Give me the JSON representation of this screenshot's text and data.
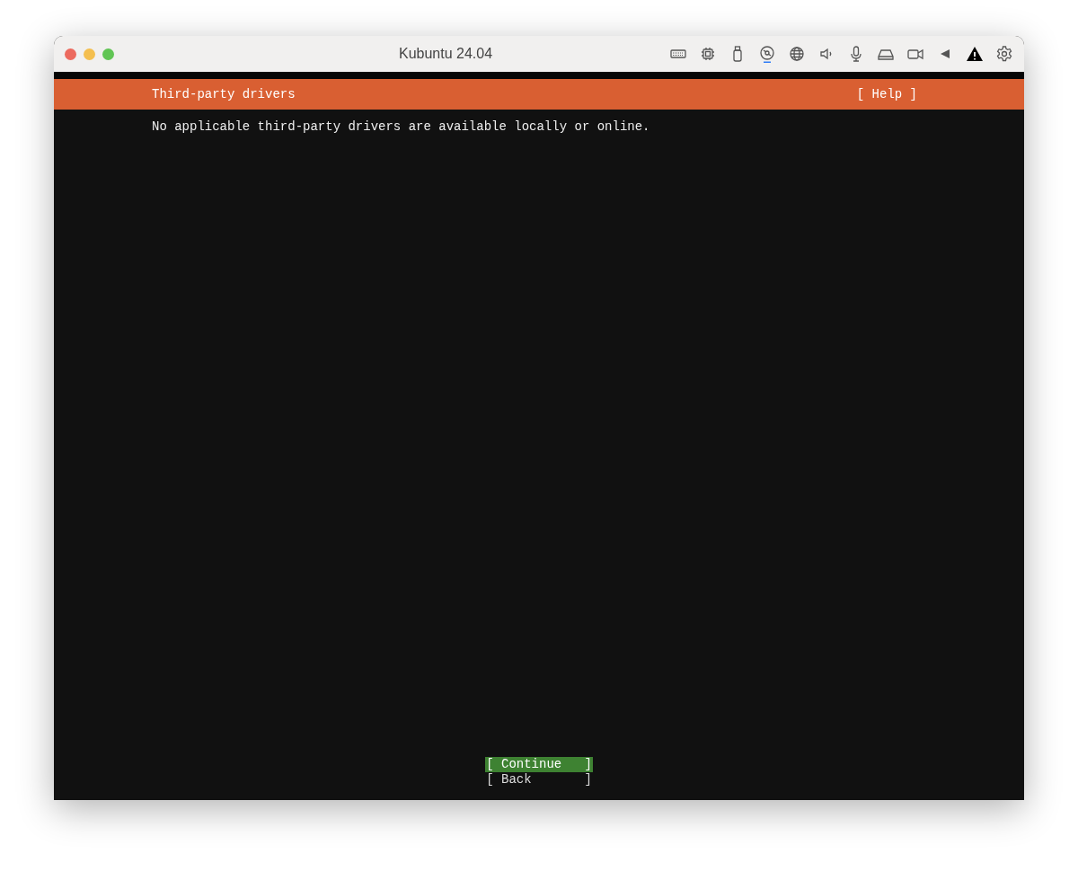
{
  "window": {
    "title": "Kubuntu 24.04"
  },
  "toolbar": [
    {
      "kind": "keyboard",
      "active": false
    },
    {
      "kind": "chip",
      "active": false
    },
    {
      "kind": "usb",
      "active": false
    },
    {
      "kind": "disc",
      "active": true
    },
    {
      "kind": "globe",
      "active": false
    },
    {
      "kind": "speaker",
      "active": false
    },
    {
      "kind": "mic",
      "active": false
    },
    {
      "kind": "drive",
      "active": false
    },
    {
      "kind": "camera",
      "active": false
    },
    {
      "kind": "triangle",
      "active": false
    },
    {
      "kind": "warning",
      "active": false
    },
    {
      "kind": "gear",
      "active": false
    }
  ],
  "header": {
    "title": "Third-party drivers",
    "help": "[ Help ]"
  },
  "message": "No applicable third-party drivers are available locally or online.",
  "buttons": [
    {
      "label": "[ Continue   ]",
      "selected": true
    },
    {
      "label": "[ Back       ]",
      "selected": false
    }
  ]
}
